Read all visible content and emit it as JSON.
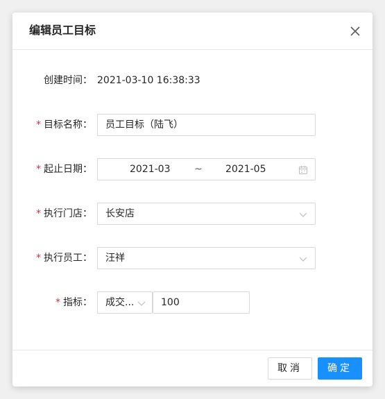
{
  "dialog": {
    "title": "编辑员工目标",
    "close_icon": "close-icon"
  },
  "form": {
    "created_time": {
      "label": "创建时间：",
      "value": "2021-03-10 16:38:33"
    },
    "goal_name": {
      "required_mark": "*",
      "label": "目标名称：",
      "value": "员工目标（陆飞）"
    },
    "date_range": {
      "required_mark": "*",
      "label": "起止日期：",
      "start": "2021-03",
      "separator": "~",
      "end": "2021-05",
      "icon": "calendar-icon"
    },
    "store": {
      "required_mark": "*",
      "label": "执行门店：",
      "value": "长安店",
      "icon": "chevron-down-icon"
    },
    "employee": {
      "required_mark": "*",
      "label": "执行员工：",
      "value": "汪祥",
      "icon": "chevron-down-icon"
    },
    "indicator": {
      "required_mark": "*",
      "label": "指标：",
      "type_value": "成交...",
      "amount": "100",
      "icon": "chevron-down-icon"
    }
  },
  "footer": {
    "cancel_label": "取消",
    "ok_label": "确定"
  },
  "colors": {
    "primary": "#1890ff",
    "required": "#f5222d",
    "border": "#d9d9d9"
  }
}
